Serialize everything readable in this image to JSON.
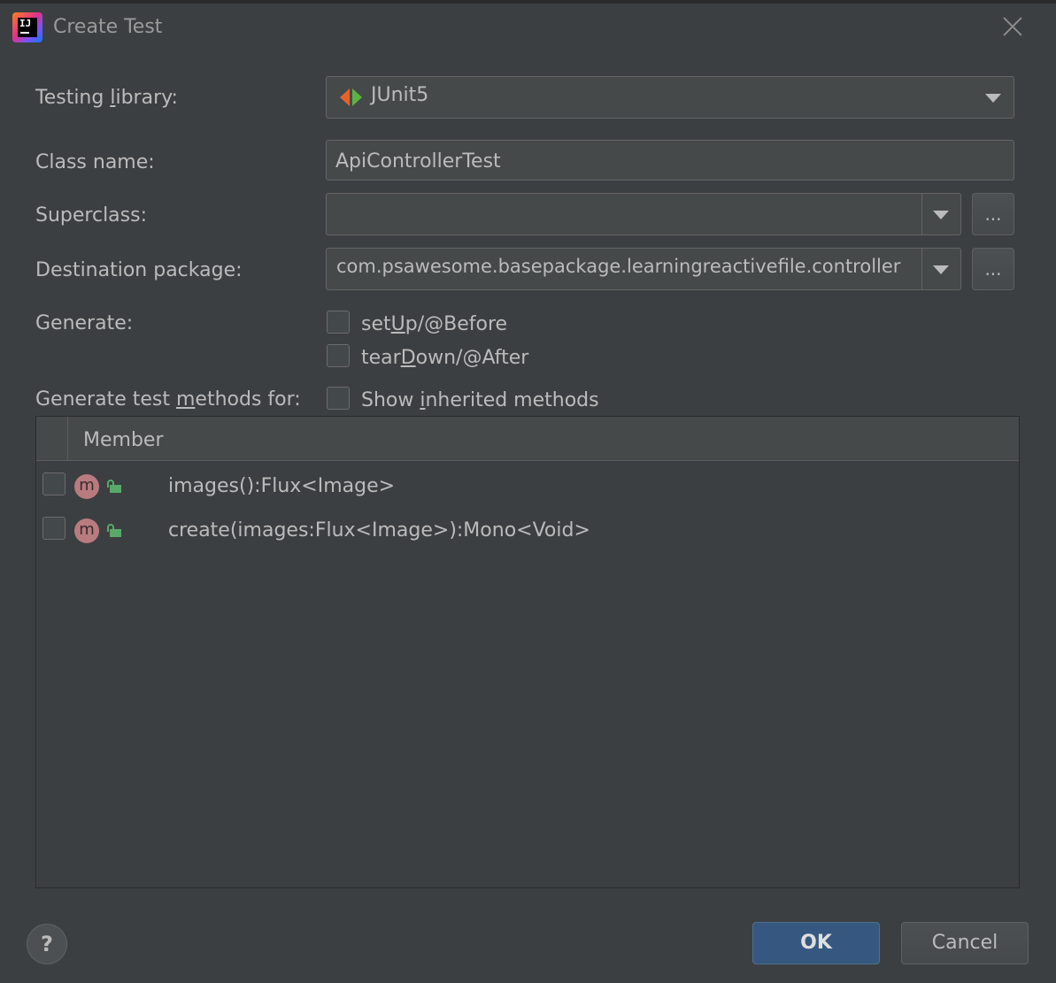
{
  "window": {
    "title": "Create Test",
    "app_icon": "intellij-idea-icon",
    "close_icon": "close-icon"
  },
  "form": {
    "testing_library": {
      "label": "Testing library:",
      "label_mnemonic": "l",
      "value": "JUnit5",
      "icon": "junit5-icon"
    },
    "class_name": {
      "label": "Class name:",
      "value": "ApiControllerTest"
    },
    "superclass": {
      "label": "Superclass:",
      "value": "",
      "browse_label": "..."
    },
    "destination_package": {
      "label": "Destination package:",
      "value": "com.psawesome.basepackage.learningreactivefile.controller",
      "browse_label": "..."
    },
    "generate": {
      "label": "Generate:",
      "options": [
        {
          "label_pre": "set",
          "label_mn": "U",
          "label_post": "p/@Before",
          "checked": false
        },
        {
          "label_pre": "tear",
          "label_mn": "D",
          "label_post": "own/@After",
          "checked": false
        }
      ]
    },
    "generate_methods": {
      "label_pre": "Generate test ",
      "label_mn": "m",
      "label_post": "ethods for:",
      "show_inherited": {
        "label_pre": "Show ",
        "label_mn": "i",
        "label_post": "nherited methods",
        "checked": false
      }
    }
  },
  "table": {
    "column_header": "Member",
    "rows": [
      {
        "signature": "images():Flux<Image>",
        "kind_letter": "m",
        "checked": false
      },
      {
        "signature": "create(images:Flux<Image>):Mono<Void>",
        "kind_letter": "m",
        "checked": false
      }
    ]
  },
  "footer": {
    "help_label": "?",
    "ok_label": "OK",
    "cancel_label": "Cancel"
  },
  "colors": {
    "background": "#3c3f41",
    "field_background": "#45494a",
    "accent_button": "#365880",
    "method_icon": "#b77b80",
    "public_lock": "#59a869"
  }
}
